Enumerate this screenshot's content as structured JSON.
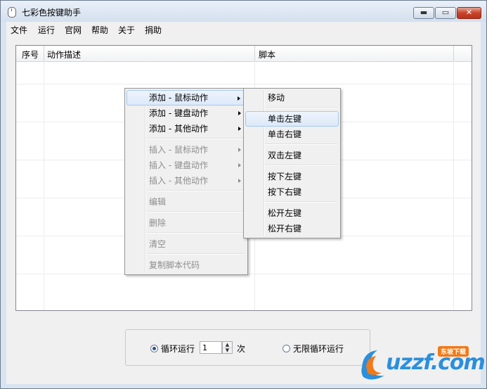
{
  "window": {
    "title": "七彩色按键助手",
    "controls": {
      "minimize": "▬",
      "maximize": "▭",
      "close": "✕"
    }
  },
  "menubar": [
    "文件",
    "运行",
    "官网",
    "帮助",
    "关于",
    "捐助"
  ],
  "listview": {
    "columns": [
      "序号",
      "动作描述",
      "脚本"
    ]
  },
  "context_menu": {
    "items": [
      {
        "label": "添加 - 鼠标动作",
        "submenu": true,
        "disabled": false,
        "highlighted": true
      },
      {
        "label": "添加 - 键盘动作",
        "submenu": true,
        "disabled": false,
        "highlighted": false
      },
      {
        "label": "添加 - 其他动作",
        "submenu": true,
        "disabled": false,
        "highlighted": false
      },
      {
        "label": "插入 - 鼠标动作",
        "submenu": true,
        "disabled": true,
        "highlighted": false
      },
      {
        "label": "插入 - 键盘动作",
        "submenu": true,
        "disabled": true,
        "highlighted": false
      },
      {
        "label": "插入 - 其他动作",
        "submenu": true,
        "disabled": true,
        "highlighted": false
      },
      {
        "label": "编辑",
        "submenu": false,
        "disabled": true,
        "highlighted": false
      },
      {
        "label": "删除",
        "submenu": false,
        "disabled": true,
        "highlighted": false
      },
      {
        "label": "清空",
        "submenu": false,
        "disabled": true,
        "highlighted": false
      },
      {
        "label": "复制脚本代码",
        "submenu": false,
        "disabled": true,
        "highlighted": false
      }
    ]
  },
  "submenu": {
    "items": [
      {
        "label": "移动",
        "highlighted": false
      },
      {
        "label": "单击左键",
        "highlighted": true
      },
      {
        "label": "单击右键",
        "highlighted": false
      },
      {
        "label": "双击左键",
        "highlighted": false
      },
      {
        "label": "按下左键",
        "highlighted": false
      },
      {
        "label": "按下右键",
        "highlighted": false
      },
      {
        "label": "松开左键",
        "highlighted": false
      },
      {
        "label": "松开右键",
        "highlighted": false
      }
    ]
  },
  "loop": {
    "loop_label": "循环运行",
    "loop_checked": true,
    "count_value": "1",
    "count_unit": "次",
    "infinite_label": "无限循环运行",
    "infinite_checked": false
  },
  "watermark": {
    "text": "uzzf.com",
    "badge": "东坡下载"
  },
  "colors": {
    "accent": "#2b8fdc",
    "highlight_border": "#a8c8ec",
    "close_button": "#c8432a"
  }
}
